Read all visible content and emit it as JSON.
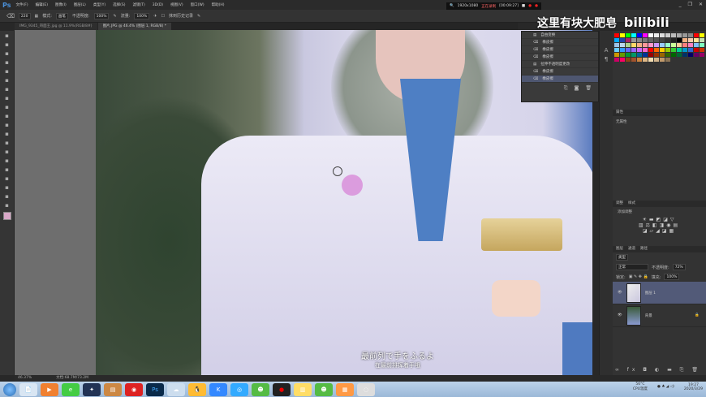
{
  "app": {
    "logo": "Ps",
    "menu": [
      "文件(F)",
      "编辑(E)",
      "图像(I)",
      "图层(L)",
      "类型(Y)",
      "选择(S)",
      "滤镜(T)",
      "3D(D)",
      "视图(V)",
      "窗口(W)",
      "帮助(H)"
    ]
  },
  "options": {
    "brush_size": "220",
    "mode_label": "模式:",
    "mode_value": "画笔",
    "opacity_label": "不透明度:",
    "opacity_value": "100%",
    "flow_label": "流量:",
    "flow_value": "100%",
    "erase_history_label": "抹到历史记录"
  },
  "recorder": {
    "resolution": "1920x1080",
    "status": "正在录制",
    "time": "[00:09:27]"
  },
  "tabs": [
    {
      "label": "IMG_9345_哥面王.jpg @ 11.9%(RGB/8#)"
    },
    {
      "label": "图片.JPG @ 46.4% (图层 1, RGB/8) *"
    }
  ],
  "status": {
    "zoom": "46.37%",
    "doc": "文档:68.7M/73.2M"
  },
  "history": {
    "items": [
      {
        "label": "自由变换",
        "icon": "doc-icon"
      },
      {
        "label": "橡皮擦",
        "icon": "eraser-icon"
      },
      {
        "label": "橡皮擦",
        "icon": "eraser-icon"
      },
      {
        "label": "橡皮擦",
        "icon": "eraser-icon"
      },
      {
        "label": "拉伸不透明度更改",
        "icon": "doc-icon"
      },
      {
        "label": "橡皮擦",
        "icon": "eraser-icon"
      },
      {
        "label": "橡皮擦",
        "icon": "eraser-icon",
        "selected": true
      }
    ]
  },
  "watermark": {
    "text": "这里有块大肥皂",
    "brand": "bilibili"
  },
  "properties": {
    "title": "属性",
    "empty": "无属性"
  },
  "adjustments": {
    "tab1": "调整",
    "tab2": "样式",
    "add": "添加调整"
  },
  "layers": {
    "tabs": [
      "图层",
      "通道",
      "路径"
    ],
    "filter": "类型",
    "blend": "正常",
    "opacity_label": "不透明度:",
    "opacity": "72%",
    "lock_label": "锁定:",
    "fill_label": "填充:",
    "fill": "100%",
    "items": [
      {
        "name": "图层 1",
        "selected": true
      },
      {
        "name": "背景",
        "locked": true
      }
    ]
  },
  "subtitles": {
    "jp": "最前列で手をふるよ",
    "cn": "在最前排挥着手哦"
  },
  "taskbar": {
    "temp": "56°C",
    "temp_label": "CPU温度",
    "time": "19:27",
    "date": "2020/3/29"
  },
  "colors": {
    "accent": "#4e5670",
    "ps_blue": "#4a90d9",
    "swatches": [
      "#ff0000",
      "#ffff00",
      "#00ff00",
      "#00ffff",
      "#0000ff",
      "#ff00ff",
      "#ffffff",
      "#eeeeee",
      "#dddddd",
      "#cccccc",
      "#bbbbbb",
      "#aaaaaa",
      "#999999",
      "#888888",
      "#ff0000",
      "#ffff00",
      "#00aaff",
      "#2244aa",
      "#aa2266",
      "#999999",
      "#888888",
      "#777777",
      "#666666",
      "#555555",
      "#444444",
      "#333333",
      "#222222",
      "#000000",
      "#f4b183",
      "#f8cbad",
      "#ffe699",
      "#c5e0b4",
      "#9dc3e6",
      "#bdd7ee",
      "#a9d18e",
      "#ffd966",
      "#f4b183",
      "#ff9999",
      "#ff99cc",
      "#cc99ff",
      "#99ccff",
      "#99ffcc",
      "#ccff99",
      "#ffcc99",
      "#ff7f7f",
      "#ff7fbf",
      "#7fbfff",
      "#7fffbf",
      "#66ccff",
      "#3399ff",
      "#6666ff",
      "#9966ff",
      "#cc66ff",
      "#ff66cc",
      "#ff0000",
      "#ff6600",
      "#ffcc00",
      "#99cc00",
      "#33cc33",
      "#00cc99",
      "#0099cc",
      "#3366cc",
      "#cc0000",
      "#cc3300",
      "#cc9900",
      "#669900",
      "#009933",
      "#009966",
      "#006699",
      "#003399",
      "#990000",
      "#993300",
      "#996600",
      "#336600",
      "#006600",
      "#006633",
      "#003366",
      "#000066",
      "#660066",
      "#990066",
      "#cc0066",
      "#ff0066",
      "#8b4513",
      "#a0522d",
      "#cd853f",
      "#deb887",
      "#f5deb3",
      "#d2b48c",
      "#c19a6b",
      "#8b7355"
    ]
  }
}
